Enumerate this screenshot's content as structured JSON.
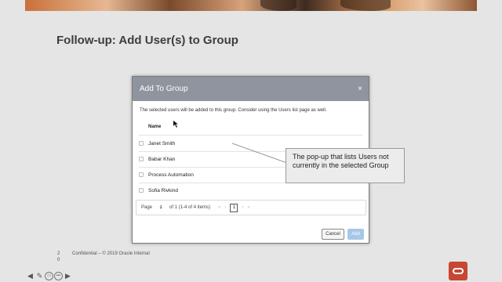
{
  "slide": {
    "title": "Follow-up: Add User(s) to Group",
    "page_number": "2\n0",
    "footer": "Confidential – © 2019 Oracle Internal"
  },
  "dialog": {
    "title": "Add To Group",
    "close": "×",
    "description": "The selected users will be added to this group. Consider using the Users list page as well.",
    "column_header": "Name",
    "rows": [
      "Janet Smith",
      "Babar Khan",
      "Process Automation",
      "Sofia Rivkind"
    ],
    "pager": {
      "label": "Page",
      "value": "1",
      "info": "of 1 (1-4 of 4 items)",
      "first": "«",
      "prev": "‹",
      "current": "1",
      "next": "›",
      "last": "»"
    },
    "cancel_label": "Cancel",
    "add_label": "Add"
  },
  "callout": {
    "text": "The pop-up that lists Users not currently in the selected Group"
  },
  "colors": {
    "dialog_header": "#8f949e",
    "add_button": "#a7c7e7",
    "oracle_red": "#c74634"
  },
  "icons": [
    "close-icon",
    "oracle-logo-icon",
    "back-arrow-icon",
    "pen-icon",
    "zoom-icon",
    "more-icon",
    "forward-arrow-icon"
  ]
}
